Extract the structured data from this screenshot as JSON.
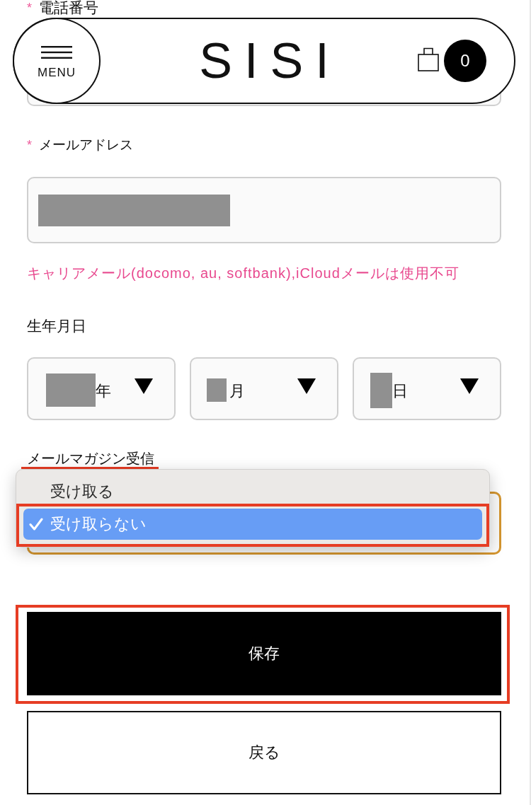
{
  "header": {
    "menu_label": "MENU",
    "logo": "SISI",
    "cart_count": "0"
  },
  "phone": {
    "required_mark": "*",
    "label": "電話番号"
  },
  "email": {
    "required_mark": "*",
    "label": "メールアドレス",
    "value_redacted": true,
    "note": "キャリアメール(docomo, au, softbank),iCloudメールは使用不可"
  },
  "birthday": {
    "label": "生年月日",
    "selects": [
      {
        "kind": "year",
        "suffix": "年",
        "value_redacted": true
      },
      {
        "kind": "month",
        "suffix": "月",
        "value_redacted": true
      },
      {
        "kind": "day",
        "suffix": "日",
        "value_redacted": true
      }
    ]
  },
  "mail_magazine": {
    "label": "メールマガジン受信",
    "label_highlighted": true,
    "focused": true,
    "expanded": true,
    "options": [
      {
        "label": "受け取る",
        "selected": false,
        "highlighted": false
      },
      {
        "label": "受け取らない",
        "selected": true,
        "highlighted": true
      }
    ]
  },
  "buttons": [
    {
      "kind": "filled",
      "label": "保存",
      "highlighted": true
    },
    {
      "kind": "outlined",
      "label": "戻る",
      "highlighted": false
    }
  ]
}
